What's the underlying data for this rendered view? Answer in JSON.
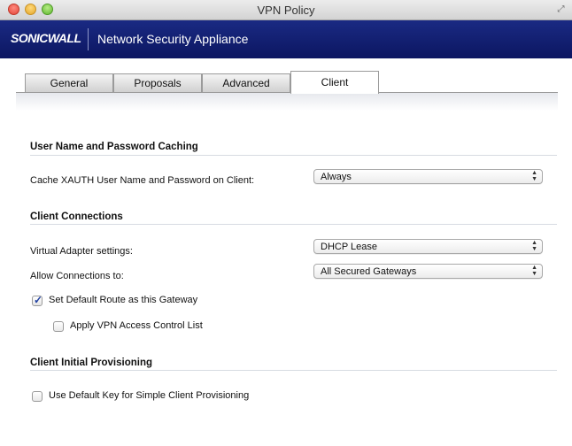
{
  "window": {
    "title": "VPN Policy"
  },
  "brand": {
    "logo": "SONICWALL",
    "product": "Network Security Appliance"
  },
  "tabs": [
    {
      "label": "General",
      "active": false
    },
    {
      "label": "Proposals",
      "active": false
    },
    {
      "label": "Advanced",
      "active": false
    },
    {
      "label": "Client",
      "active": true
    }
  ],
  "sections": {
    "caching": {
      "title": "User Name and Password Caching",
      "cache_label": "Cache XAUTH User Name and Password on Client:",
      "cache_value": "Always"
    },
    "connections": {
      "title": "Client Connections",
      "adapter_label": "Virtual Adapter settings:",
      "adapter_value": "DHCP Lease",
      "allow_label": "Allow Connections to:",
      "allow_value": "All Secured Gateways",
      "default_route_label": "Set Default Route as this Gateway",
      "default_route_checked": true,
      "apply_acl_label": "Apply VPN Access Control List",
      "apply_acl_checked": false
    },
    "provisioning": {
      "title": "Client Initial Provisioning",
      "default_key_label": "Use Default Key for Simple Client Provisioning",
      "default_key_checked": false
    }
  },
  "colors": {
    "brand_bar": "#1a2a83",
    "check_mark": "#1f3fa0"
  },
  "icons": {
    "select_arrows": "up-down-chevron-icon",
    "check": "checkmark-icon"
  }
}
